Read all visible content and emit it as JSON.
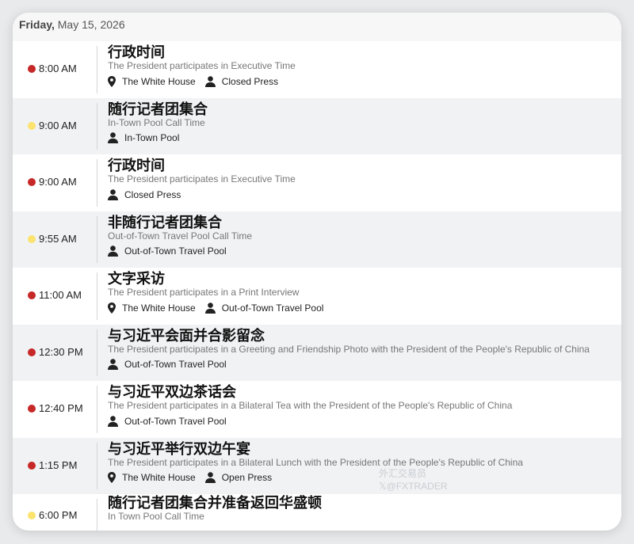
{
  "date": {
    "weekday": "Friday,",
    "rest": "May 15, 2026"
  },
  "colors": {
    "red_dot": "#c62828",
    "yellow_dot": "#fbe36e"
  },
  "events": [
    {
      "time": "8:00 AM",
      "dot": "red",
      "title": "行政时间",
      "subtitle": "The President participates in Executive Time",
      "meta": [
        {
          "icon": "location-pin-icon",
          "label": "The White House"
        },
        {
          "icon": "person-icon",
          "label": "Closed Press"
        }
      ]
    },
    {
      "time": "9:00 AM",
      "dot": "yellow",
      "title": "随行记者团集合",
      "subtitle": "In-Town Pool Call Time",
      "meta": [
        {
          "icon": "person-icon",
          "label": "In-Town Pool"
        }
      ]
    },
    {
      "time": "9:00 AM",
      "dot": "red",
      "title": "行政时间",
      "subtitle": "The President participates in Executive Time",
      "meta": [
        {
          "icon": "person-icon",
          "label": "Closed Press"
        }
      ]
    },
    {
      "time": "9:55 AM",
      "dot": "yellow",
      "title": "非随行记者团集合",
      "subtitle": "Out-of-Town Travel Pool Call Time",
      "meta": [
        {
          "icon": "person-icon",
          "label": "Out-of-Town Travel Pool"
        }
      ]
    },
    {
      "time": "11:00 AM",
      "dot": "red",
      "title": "文字采访",
      "subtitle": "The President participates in a Print Interview",
      "meta": [
        {
          "icon": "location-pin-icon",
          "label": "The White House"
        },
        {
          "icon": "person-icon",
          "label": "Out-of-Town Travel Pool"
        }
      ]
    },
    {
      "time": "12:30 PM",
      "dot": "red",
      "title": "与习近平会面并合影留念",
      "subtitle": "The President participates in a Greeting and Friendship Photo with the President of the People's Republic of China",
      "meta": [
        {
          "icon": "person-icon",
          "label": "Out-of-Town Travel Pool"
        }
      ]
    },
    {
      "time": "12:40 PM",
      "dot": "red",
      "title": "与习近平双边茶话会",
      "subtitle": "The President participates in a Bilateral Tea with the President of the People's Republic of China",
      "meta": [
        {
          "icon": "person-icon",
          "label": "Out-of-Town Travel Pool"
        }
      ]
    },
    {
      "time": "1:15 PM",
      "dot": "red",
      "title": "与习近平举行双边午宴",
      "subtitle": "The President participates in a Bilateral Lunch with the President of the People's Republic of China",
      "meta": [
        {
          "icon": "location-pin-icon",
          "label": "The White House"
        },
        {
          "icon": "person-icon",
          "label": "Open Press"
        }
      ]
    },
    {
      "time": "6:00 PM",
      "dot": "yellow",
      "title": "随行记者团集合并准备返回华盛顿",
      "subtitle": "In Town Pool Call Time",
      "meta": []
    }
  ],
  "watermark": {
    "line1": "外汇交易员",
    "line2": "𝕏@FXTRADER"
  }
}
